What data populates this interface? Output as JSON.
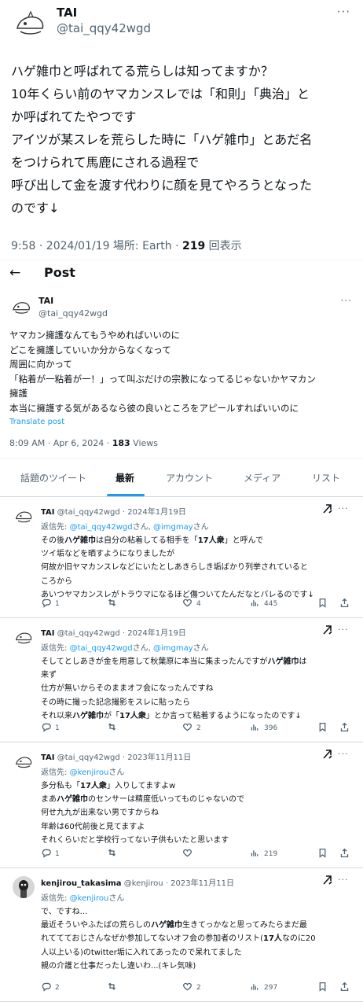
{
  "main_tweet": {
    "author_name": "TAI",
    "author_handle": "@tai_qqy42wgd",
    "more_label": "···",
    "lines": [
      "ハゲ雑巾と呼ばれてる荒らしは知ってますか？",
      "10年くらい前のヤマカンスレでは「和則」「典治」と",
      "か呼ばれてたやつです",
      "アイツが某スレを荒らした時に「ハゲ雑巾」とあだ名",
      "をつけられて馬鹿にされる過程で",
      "呼び出して金を渡す代わりに顔を見てやろうとなった",
      "のです↓"
    ],
    "meta_prefix": "9:58 · 2024/01/19 場所: Earth · ",
    "views_count": "219",
    "views_label": " 回表示"
  },
  "quoted_post": {
    "back_label": "←",
    "header_title": "Post",
    "author_name": "TAI",
    "author_handle": "@tai_qqy42wgd",
    "more_label": "···",
    "lines": [
      "ヤマカン擁護なんてもうやめればいいのに",
      "どこを擁護していいか分からなくなって",
      "周囲に向かって",
      "「粘着が一粘着が一！」って叫ぶだけの宗教になってるじゃないかヤマカン",
      "擁護",
      "本当に擁護する気があるなら彼の良いところをアピールすればいいのに"
    ],
    "translate_label": "Translate post",
    "meta_prefix": "8:09 AM · Apr 6, 2024 · ",
    "views_count": "183",
    "views_label": " Views"
  },
  "tabs": [
    {
      "label": "話題のツイート",
      "active": false
    },
    {
      "label": "最新",
      "active": true
    },
    {
      "label": "アカウント",
      "active": false
    },
    {
      "label": "メディア",
      "active": false
    },
    {
      "label": "リスト",
      "active": false
    }
  ],
  "replies": [
    {
      "name": "TAI",
      "handle": "@tai_qqy42wgd",
      "date": "2024年1月19日",
      "reply_prefix": "返信先: ",
      "mentions": "@tai_qqy42wgd",
      "mid": "さん, ",
      "mentions2": "@imgmay",
      "suffix": "さん",
      "lines": [
        [
          {
            "t": "その後"
          },
          {
            "t": "ハゲ雑巾",
            "b": true
          },
          {
            "t": "は自分の粘着してる相手を「"
          },
          {
            "t": "17人衆",
            "b": true
          },
          {
            "t": "」と呼んで"
          }
        ],
        [
          {
            "t": "ツイ垢などを晒すようになりましたが"
          }
        ],
        [
          {
            "t": "何故か旧ヤマカンスレなどにいたとしあきらしき垢ばかり列挙されていると"
          }
        ],
        [
          {
            "t": "ころから"
          }
        ],
        [
          {
            "t": "あいつヤマカンスレがトラウマになるほど傷ついてたんだなとバレるのです↓"
          }
        ]
      ],
      "replies": "1",
      "retweets": "",
      "likes": "4",
      "views": "445"
    },
    {
      "name": "TAI",
      "handle": "@tai_qqy42wgd",
      "date": "2024年1月19日",
      "reply_prefix": "返信先: ",
      "mentions": "@tai_qqy42wgd",
      "mid": "さん, ",
      "mentions2": "@imgmay",
      "suffix": "さん",
      "lines": [
        [
          {
            "t": "そしてとしあきが金を用意して秋葉原に本当に集まったんですが"
          },
          {
            "t": "ハゲ雑巾",
            "b": true
          },
          {
            "t": "は"
          }
        ],
        [
          {
            "t": "来ず"
          }
        ],
        [
          {
            "t": "仕方が無いからそのままオフ会になったんですね"
          }
        ],
        [
          {
            "t": "その時に撮った記念撮影をスレに貼ったら"
          }
        ],
        [
          {
            "t": "それ以来"
          },
          {
            "t": "ハゲ雑巾",
            "b": true
          },
          {
            "t": "が「"
          },
          {
            "t": "17人衆",
            "b": true
          },
          {
            "t": "」とか言って粘着するようになったのです↓"
          }
        ]
      ],
      "replies": "1",
      "retweets": "",
      "likes": "2",
      "views": "396"
    },
    {
      "name": "TAI",
      "handle": "@tai_qqy42wgd",
      "date": "2023年11月11日",
      "reply_prefix": "返信先: ",
      "mentions": "@kenjirou",
      "mid": "さん",
      "mentions2": "",
      "suffix": "",
      "lines": [
        [
          {
            "t": "多分私も「"
          },
          {
            "t": "17人衆",
            "b": true
          },
          {
            "t": "」入りしてますよw"
          }
        ],
        [
          {
            "t": "まあ"
          },
          {
            "t": "ハゲ雑巾",
            "b": true
          },
          {
            "t": "のセンサーは精度低いってものじゃないので"
          }
        ],
        [
          {
            "t": "何せ九九が出来ない男ですからね"
          }
        ],
        [
          {
            "t": "年齢は60代前後と見てますよ"
          }
        ],
        [
          {
            "t": "それくらいだと学校行ってない子供もいたと思います"
          }
        ]
      ],
      "replies": "1",
      "retweets": "",
      "likes": "",
      "views": "219"
    },
    {
      "name": "kenjirou_takasima",
      "handle": "@kenjirou",
      "date": "2023年11月11日",
      "reply_prefix": "返信先: ",
      "mentions": "@kenjirou",
      "mid": "さん",
      "mentions2": "",
      "suffix": "",
      "lines": [
        [
          {
            "t": "で、ですね..."
          }
        ],
        [
          {
            "t": "最近そういやふたばの荒らしの"
          },
          {
            "t": "ハゲ雑巾",
            "b": true
          },
          {
            "t": "生きてっかなと思ってみたらまだ最"
          }
        ],
        [
          {
            "t": "れててておじさんなぜか参加してないオフ会の参加者のリスト("
          },
          {
            "t": "17人",
            "b": true
          },
          {
            "t": "なのに20"
          }
        ],
        [
          {
            "t": "人以上いる)のtwitter垢に入れてあったので呆れてました"
          }
        ],
        [
          {
            "t": "親の介護と仕事だったし違いわ...(キレ気味)"
          }
        ]
      ],
      "replies": "2",
      "retweets": "",
      "likes": "2",
      "views": "297"
    }
  ],
  "icons": {
    "reply": "reply-icon",
    "retweet": "retweet-icon",
    "like": "heart-icon",
    "views": "views-icon",
    "bookmark": "bookmark-icon",
    "share": "share-icon",
    "grok": "grok-icon"
  },
  "colors": {
    "accent": "#1d9bf0",
    "text": "#0f1419",
    "muted": "#536471",
    "border": "#cfd9de"
  }
}
